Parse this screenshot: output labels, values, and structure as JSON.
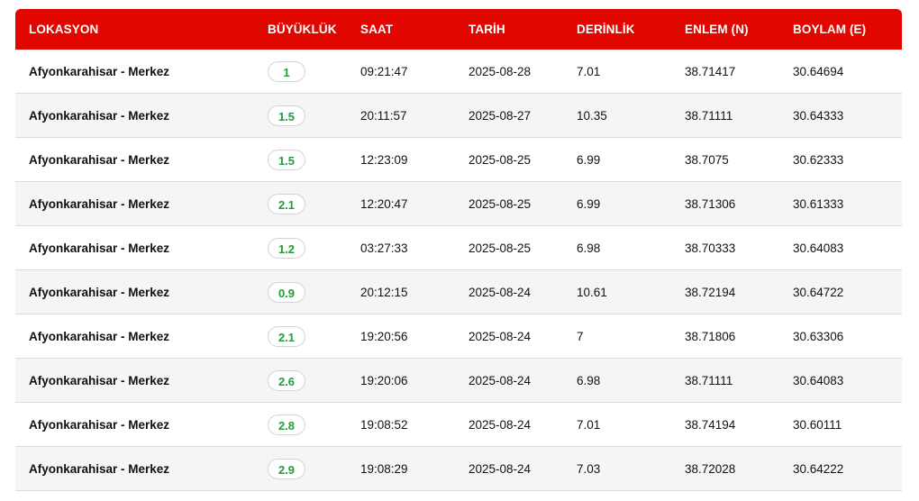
{
  "table": {
    "headers": {
      "location": "LOKASYON",
      "magnitude": "BÜYÜKLÜK",
      "time": "SAAT",
      "date": "TARİH",
      "depth": "DERİNLİK",
      "lat": "ENLEM (N)",
      "lon": "BOYLAM (E)"
    },
    "rows": [
      {
        "location": "Afyonkarahisar - Merkez",
        "magnitude": "1",
        "time": "09:21:47",
        "date": "2025-08-28",
        "depth": "7.01",
        "lat": "38.71417",
        "lon": "30.64694"
      },
      {
        "location": "Afyonkarahisar - Merkez",
        "magnitude": "1.5",
        "time": "20:11:57",
        "date": "2025-08-27",
        "depth": "10.35",
        "lat": "38.71111",
        "lon": "30.64333"
      },
      {
        "location": "Afyonkarahisar - Merkez",
        "magnitude": "1.5",
        "time": "12:23:09",
        "date": "2025-08-25",
        "depth": "6.99",
        "lat": "38.7075",
        "lon": "30.62333"
      },
      {
        "location": "Afyonkarahisar - Merkez",
        "magnitude": "2.1",
        "time": "12:20:47",
        "date": "2025-08-25",
        "depth": "6.99",
        "lat": "38.71306",
        "lon": "30.61333"
      },
      {
        "location": "Afyonkarahisar - Merkez",
        "magnitude": "1.2",
        "time": "03:27:33",
        "date": "2025-08-25",
        "depth": "6.98",
        "lat": "38.70333",
        "lon": "30.64083"
      },
      {
        "location": "Afyonkarahisar - Merkez",
        "magnitude": "0.9",
        "time": "20:12:15",
        "date": "2025-08-24",
        "depth": "10.61",
        "lat": "38.72194",
        "lon": "30.64722"
      },
      {
        "location": "Afyonkarahisar - Merkez",
        "magnitude": "2.1",
        "time": "19:20:56",
        "date": "2025-08-24",
        "depth": "7",
        "lat": "38.71806",
        "lon": "30.63306"
      },
      {
        "location": "Afyonkarahisar - Merkez",
        "magnitude": "2.6",
        "time": "19:20:06",
        "date": "2025-08-24",
        "depth": "6.98",
        "lat": "38.71111",
        "lon": "30.64083"
      },
      {
        "location": "Afyonkarahisar - Merkez",
        "magnitude": "2.8",
        "time": "19:08:52",
        "date": "2025-08-24",
        "depth": "7.01",
        "lat": "38.74194",
        "lon": "30.60111"
      },
      {
        "location": "Afyonkarahisar - Merkez",
        "magnitude": "2.9",
        "time": "19:08:29",
        "date": "2025-08-24",
        "depth": "7.03",
        "lat": "38.72028",
        "lon": "30.64222"
      }
    ]
  },
  "colors": {
    "header_bg": "#e10600",
    "magnitude_text": "#1f9e3a"
  }
}
